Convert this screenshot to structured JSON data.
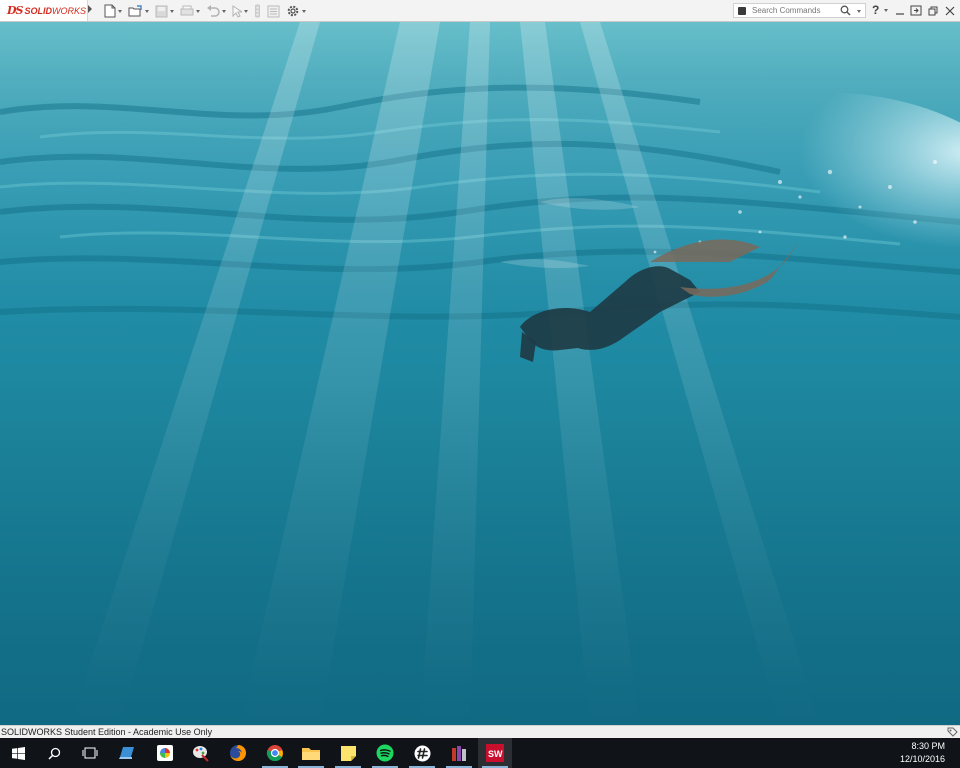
{
  "app": {
    "logo_mark": "DS",
    "logo_text_bold": "SOLID",
    "logo_text_thin": "WORKS"
  },
  "toolbar": {
    "tools": [
      "new",
      "open",
      "save",
      "print",
      "undo",
      "select",
      "rebuild",
      "file-properties",
      "options"
    ]
  },
  "search": {
    "placeholder": "Search Commands"
  },
  "help": {
    "label": "?"
  },
  "status": {
    "text": "SOLIDWORKS Student Edition - Academic Use Only"
  },
  "taskbar": {
    "apps": [
      "start",
      "search",
      "task-view",
      "laptop-app",
      "photos",
      "paint",
      "firefox",
      "chrome",
      "file-explorer",
      "sticky-notes",
      "spotify",
      "slack",
      "archive-app",
      "solidworks"
    ],
    "active_app": "solidworks",
    "clock": {
      "time": "8:30 PM",
      "date": "12/10/2016"
    }
  },
  "colors": {
    "brand": "#d52b1e",
    "taskbar": "#101418",
    "water": "#1f8aa3"
  }
}
